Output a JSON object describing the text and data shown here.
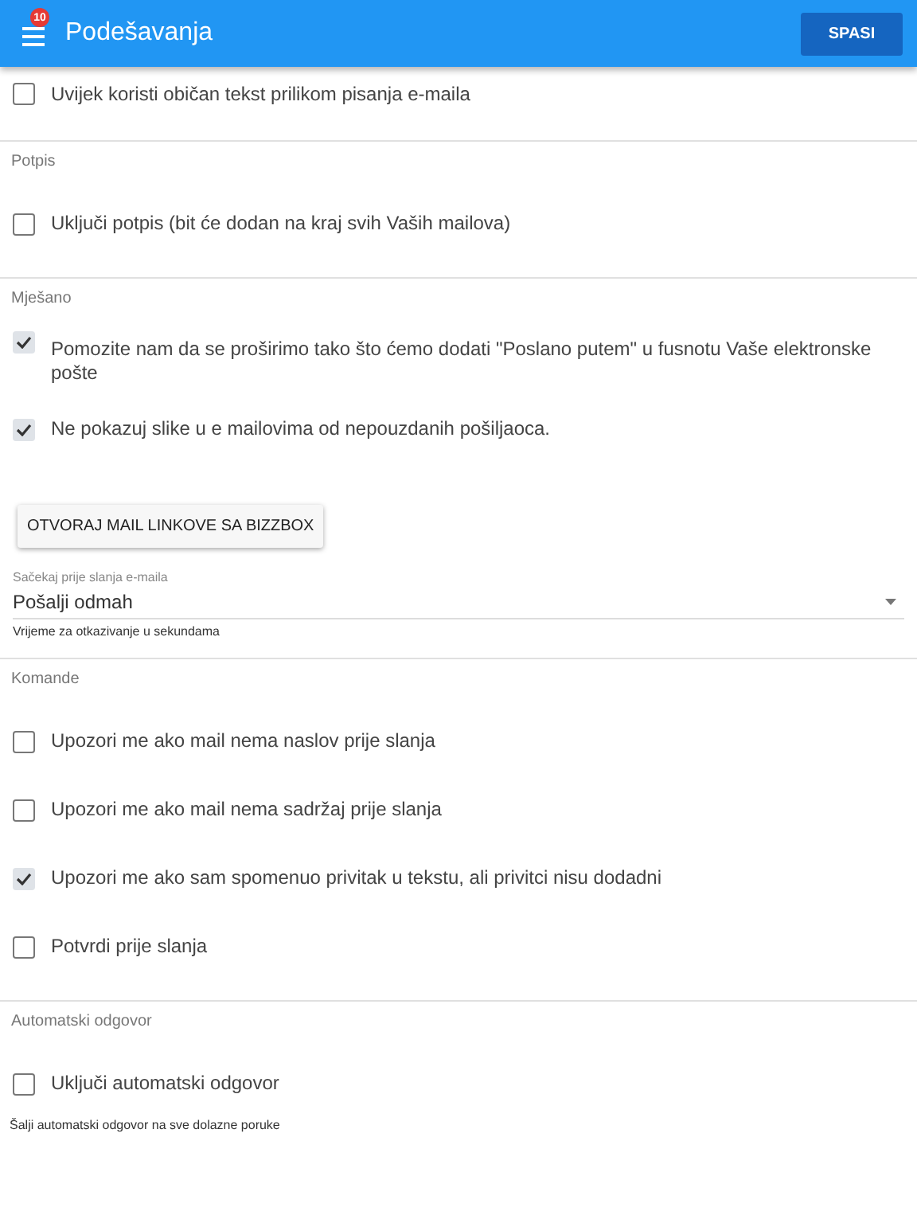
{
  "header": {
    "title": "Podešavanja",
    "badge": "10",
    "save_button": "SPASI"
  },
  "sections": [
    {
      "items": [
        {
          "kind": "checkbox",
          "label": "Uvijek koristi običan tekst prilikom pisanja e-maila",
          "checked": false
        }
      ]
    },
    {
      "heading": "Potpis",
      "items": [
        {
          "kind": "checkbox",
          "label": "Uključi potpis (bit će dodan na kraj svih Vaših mailova)",
          "checked": false
        }
      ]
    },
    {
      "heading": "Mješano",
      "items": [
        {
          "kind": "checkbox",
          "label": "Pomozite nam da se proširimo tako što ćemo dodati \"Poslano putem\" u fusnotu Vaše elektronske pošte",
          "checked": true
        },
        {
          "kind": "checkbox",
          "label": "Ne pokazuj slike u e mailovima od nepouzdanih pošiljaoca.",
          "checked": true
        },
        {
          "kind": "button",
          "label": "OTVORAJ MAIL LINKOVE SA BIZZBOX"
        },
        {
          "kind": "select",
          "label": "Sačekaj prije slanja e-maila",
          "value": "Pošalji odmah",
          "hint": "Vrijeme za otkazivanje u sekundama"
        }
      ]
    },
    {
      "heading": "Komande",
      "items": [
        {
          "kind": "checkbox",
          "label": "Upozori me ako mail nema naslov prije slanja",
          "checked": false
        },
        {
          "kind": "checkbox",
          "label": "Upozori me ako mail nema sadržaj prije slanja",
          "checked": false
        },
        {
          "kind": "checkbox",
          "label": "Upozori me ako sam spomenuo privitak u tekstu, ali privitci nisu dodadni",
          "checked": true
        },
        {
          "kind": "checkbox",
          "label": "Potvrdi prije slanja",
          "checked": false
        }
      ]
    },
    {
      "heading": "Automatski odgovor",
      "items": [
        {
          "kind": "checkbox",
          "label": "Uključi automatski odgovor",
          "checked": false
        },
        {
          "kind": "note",
          "text": "Šalji automatski odgovor na sve dolazne poruke"
        }
      ]
    }
  ]
}
